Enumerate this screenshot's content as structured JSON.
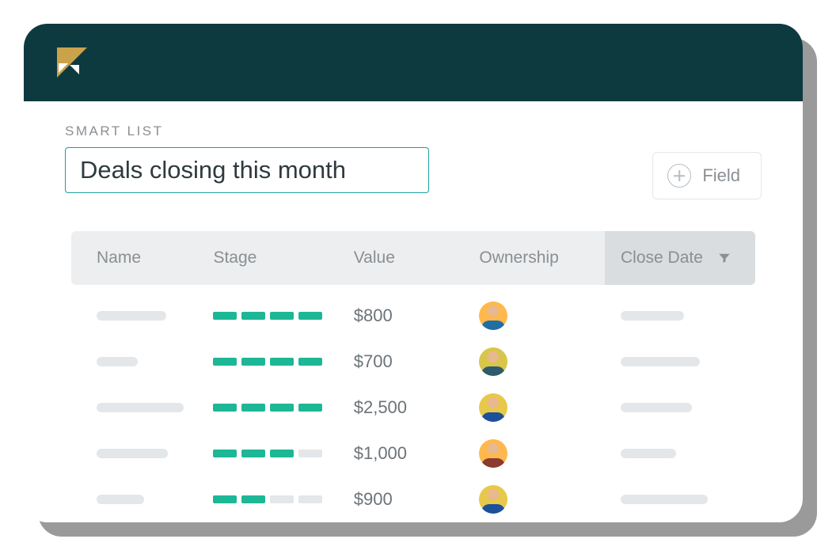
{
  "section_label": "SMART LIST",
  "list_title": "Deals closing this month",
  "field_button": "Field",
  "columns": {
    "name": "Name",
    "stage": "Stage",
    "value": "Value",
    "ownership": "Ownership",
    "close_date": "Close Date"
  },
  "rows": [
    {
      "name_width": 88,
      "stage_fill": 4,
      "value": "$800",
      "avatar_bg": "#ffb84d",
      "shirt": "#1f6fa3",
      "close_width": 80
    },
    {
      "name_width": 52,
      "stage_fill": 4,
      "value": "$700",
      "avatar_bg": "#d8c64a",
      "shirt": "#2e5a6b",
      "close_width": 100
    },
    {
      "name_width": 110,
      "stage_fill": 4,
      "value": "$2,500",
      "avatar_bg": "#e8c84a",
      "shirt": "#1c4f9c",
      "close_width": 90
    },
    {
      "name_width": 90,
      "stage_fill": 3,
      "value": "$1,000",
      "avatar_bg": "#ffb84d",
      "shirt": "#8a3a2e",
      "close_width": 70
    },
    {
      "name_width": 60,
      "stage_fill": 2,
      "value": "$900",
      "avatar_bg": "#e8c84a",
      "shirt": "#1c4f9c",
      "close_width": 110
    }
  ]
}
